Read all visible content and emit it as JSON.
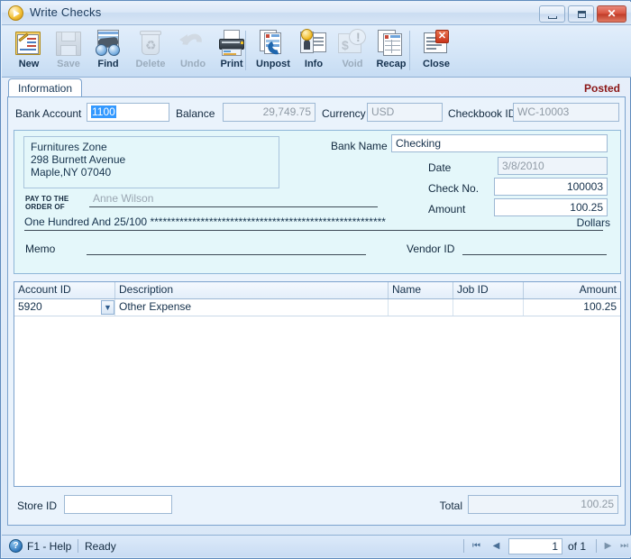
{
  "window": {
    "title": "Write Checks",
    "app_icon": "play-circle-icon",
    "controls": {
      "minimize": "minimize-icon",
      "maximize": "maximize-icon",
      "close": "✕"
    }
  },
  "toolbar": {
    "buttons": [
      {
        "label": "New",
        "icon": "new-document-icon",
        "enabled": true
      },
      {
        "label": "Save",
        "icon": "floppy-disk-icon",
        "enabled": false
      },
      {
        "label": "Find",
        "icon": "binoculars-icon",
        "enabled": true
      },
      {
        "label": "Delete",
        "icon": "recycle-bin-icon",
        "enabled": false
      },
      {
        "label": "Undo",
        "icon": "undo-arrow-icon",
        "enabled": false
      },
      {
        "label": "Print",
        "icon": "printer-icon",
        "enabled": true
      },
      {
        "label": "Unpost",
        "icon": "unpost-icon",
        "enabled": true
      },
      {
        "label": "Info",
        "icon": "info-badge-icon",
        "enabled": true
      },
      {
        "label": "Void",
        "icon": "void-stamp-icon",
        "enabled": false
      },
      {
        "label": "Recap",
        "icon": "recap-report-icon",
        "enabled": true
      },
      {
        "label": "Close",
        "icon": "close-window-icon",
        "enabled": true
      }
    ]
  },
  "tabs": {
    "items": [
      {
        "label": "Information",
        "active": true
      }
    ],
    "status_badge": "Posted"
  },
  "header_fields": {
    "bank_account": {
      "label": "Bank Account",
      "value": "1100",
      "selected": true
    },
    "balance": {
      "label": "Balance",
      "value": "29,749.75",
      "readonly": true
    },
    "currency": {
      "label": "Currency",
      "value": "USD",
      "readonly": true
    },
    "checkbook_id": {
      "label": "Checkbook ID",
      "value": "WC-10003",
      "readonly": true
    }
  },
  "check": {
    "address_block": "Furnitures Zone\n298 Burnett Avenue\nMaple,NY 07040",
    "address_lines": [
      "Furnitures Zone",
      "298 Burnett Avenue",
      "Maple,NY 07040"
    ],
    "pay_to_label_line1": "PAY TO THE",
    "pay_to_label_line2": "ORDER OF",
    "payee": "Anne Wilson",
    "amount_in_words": "One Hundred  And 25/100 ********************************************************",
    "dollars_label": "Dollars",
    "memo": {
      "label": "Memo",
      "value": ""
    },
    "vendor_id": {
      "label": "Vendor ID",
      "value": ""
    },
    "bank_name": {
      "label": "Bank Name",
      "value": "Checking"
    },
    "date": {
      "label": "Date",
      "value": "3/8/2010",
      "readonly": true
    },
    "check_no": {
      "label": "Check No.",
      "value": "100003"
    },
    "amount": {
      "label": "Amount",
      "value": "100.25"
    }
  },
  "grid": {
    "columns": [
      {
        "label": "Account ID",
        "align": "left"
      },
      {
        "label": "Description",
        "align": "left"
      },
      {
        "label": "Name",
        "align": "left"
      },
      {
        "label": "Job ID",
        "align": "left"
      },
      {
        "label": "Amount",
        "align": "right"
      }
    ],
    "rows": [
      {
        "account_id": "5920",
        "description": "Other Expense",
        "name": "",
        "job_id": "",
        "amount": "100.25",
        "dropdown_icon": "chevron-down-icon"
      }
    ]
  },
  "footer": {
    "store_id": {
      "label": "Store ID",
      "value": ""
    },
    "total": {
      "label": "Total",
      "value": "100.25"
    }
  },
  "statusbar": {
    "help_icon": "question-mark-icon",
    "help_text": "F1 - Help",
    "status_text": "Ready",
    "nav": {
      "first_icon": "nav-first-icon",
      "prev_icon": "nav-prev-icon",
      "next_icon": "nav-next-icon",
      "last_icon": "nav-last-icon",
      "page_value": "1",
      "of_text": "of 1"
    }
  },
  "colors": {
    "accent": "#3399ff",
    "posted": "#8b1616",
    "window_border": "#5f8bbd",
    "check_bg": "#e4f7fa",
    "panel_bg": "#eaf3fc",
    "close_button": "#c9341a"
  }
}
